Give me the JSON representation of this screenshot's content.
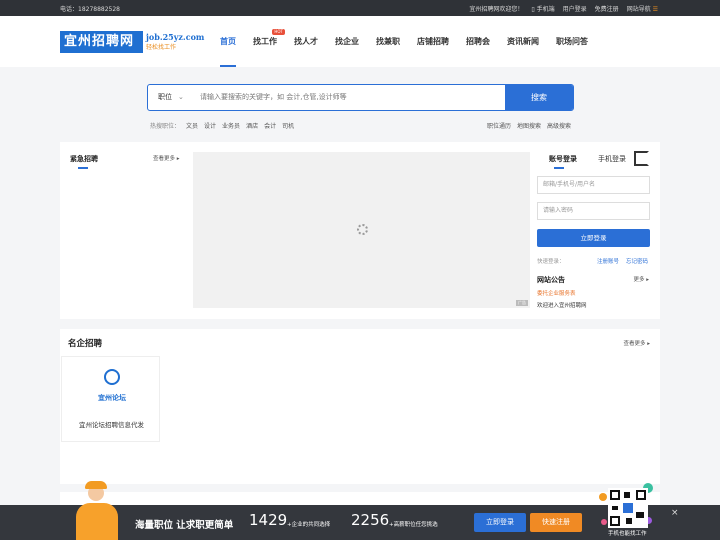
{
  "topbar": {
    "phone": "电话：18278882528",
    "welcome": "宜州招聘网欢迎您！",
    "mobile": "手机端",
    "login": "用户登录",
    "register": "免费注册",
    "sitenav": "网站导航"
  },
  "brand": {
    "name": "宜州招聘网",
    "domain": "job.25yz.com",
    "slogan": "轻松找工作"
  },
  "nav": [
    {
      "label": "首页",
      "active": true
    },
    {
      "label": "找工作",
      "hot": "HOT"
    },
    {
      "label": "找人才"
    },
    {
      "label": "找企业"
    },
    {
      "label": "找兼职"
    },
    {
      "label": "店铺招聘"
    },
    {
      "label": "招聘会"
    },
    {
      "label": "资讯新闻"
    },
    {
      "label": "职场问答"
    }
  ],
  "search": {
    "type": "职位",
    "placeholder": "请输入要搜索的关键字，如 会计,仓管,设计师等",
    "button": "搜索",
    "hot_label": "热搜职位：",
    "hot_keywords": [
      "文员",
      "设计",
      "业务员",
      "酒店",
      "会计",
      "司机"
    ],
    "links": [
      "职位通历",
      "地图搜索",
      "高级搜索"
    ]
  },
  "urgent": {
    "title": "紧急招聘",
    "more": "查看更多"
  },
  "banner": {
    "ad_tag": "广告"
  },
  "login_box": {
    "tab_account": "账号登录",
    "tab_mobile": "手机登录",
    "user_placeholder": "邮箱/手机号/用户名",
    "pass_placeholder": "请输入密码",
    "submit": "立即登录",
    "quick": "快速登录：",
    "register": "注册账号",
    "forget": "忘记密码"
  },
  "notice": {
    "title": "网站公告",
    "more": "更多",
    "items": [
      "委托企业服务表",
      "欢迎进入宜州招聘网"
    ]
  },
  "famous": {
    "title": "名企招聘",
    "more": "查看更多",
    "cards": [
      {
        "logo_text": "宜州论坛",
        "name": "宜州论坛招聘信息代发"
      }
    ]
  },
  "footer_bar": {
    "slogan": "海量职位 让求职更简单",
    "count1": "1429",
    "desc1": "+企业的共同选择",
    "count2": "2256",
    "desc2": "+高薪职位任您挑选",
    "login_btn": "立即登录",
    "register_btn": "快速注册",
    "qr_caption": "手机也能找工作",
    "close": "×"
  },
  "colors": {
    "primary": "#2b6fd6",
    "accent": "#f08a24",
    "topbar": "#2f3237"
  }
}
